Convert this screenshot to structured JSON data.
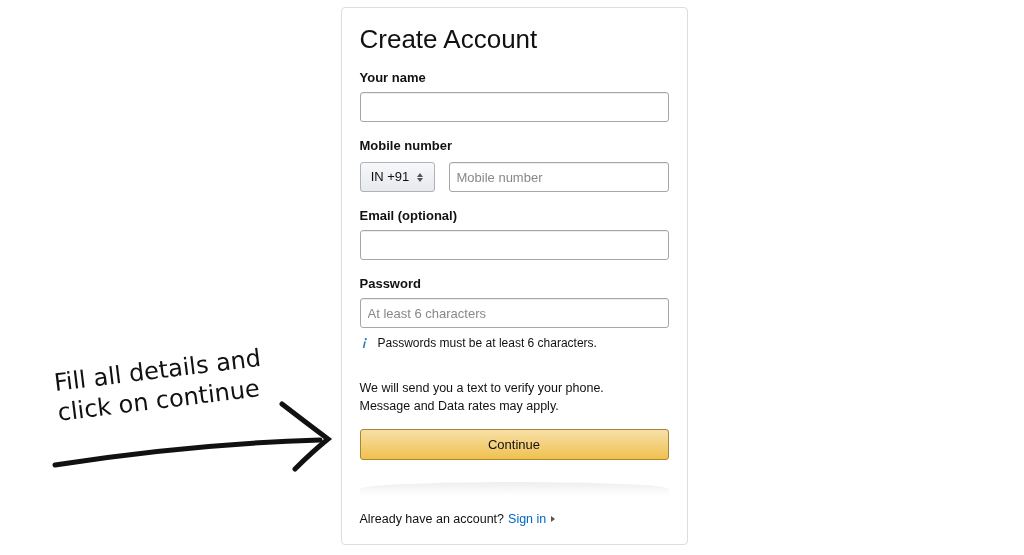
{
  "title": "Create Account",
  "fields": [
    {
      "label": "Your name",
      "kind": "text"
    },
    {
      "label": "Mobile number",
      "kind": "phone",
      "country_code": "IN +91",
      "placeholder": "Mobile number"
    },
    {
      "label": "Email (optional)",
      "kind": "text"
    },
    {
      "label": "Password",
      "kind": "text",
      "placeholder": "At least 6 characters",
      "hint": "Passwords must be at least 6 characters."
    }
  ],
  "notice": [
    "We will send you a text to verify your phone.",
    "Message and Data rates may apply."
  ],
  "button": "Continue",
  "footer": {
    "text": "Already have an account?",
    "link": "Sign in"
  },
  "annotation": [
    "Fill all details and",
    "click on continue"
  ]
}
